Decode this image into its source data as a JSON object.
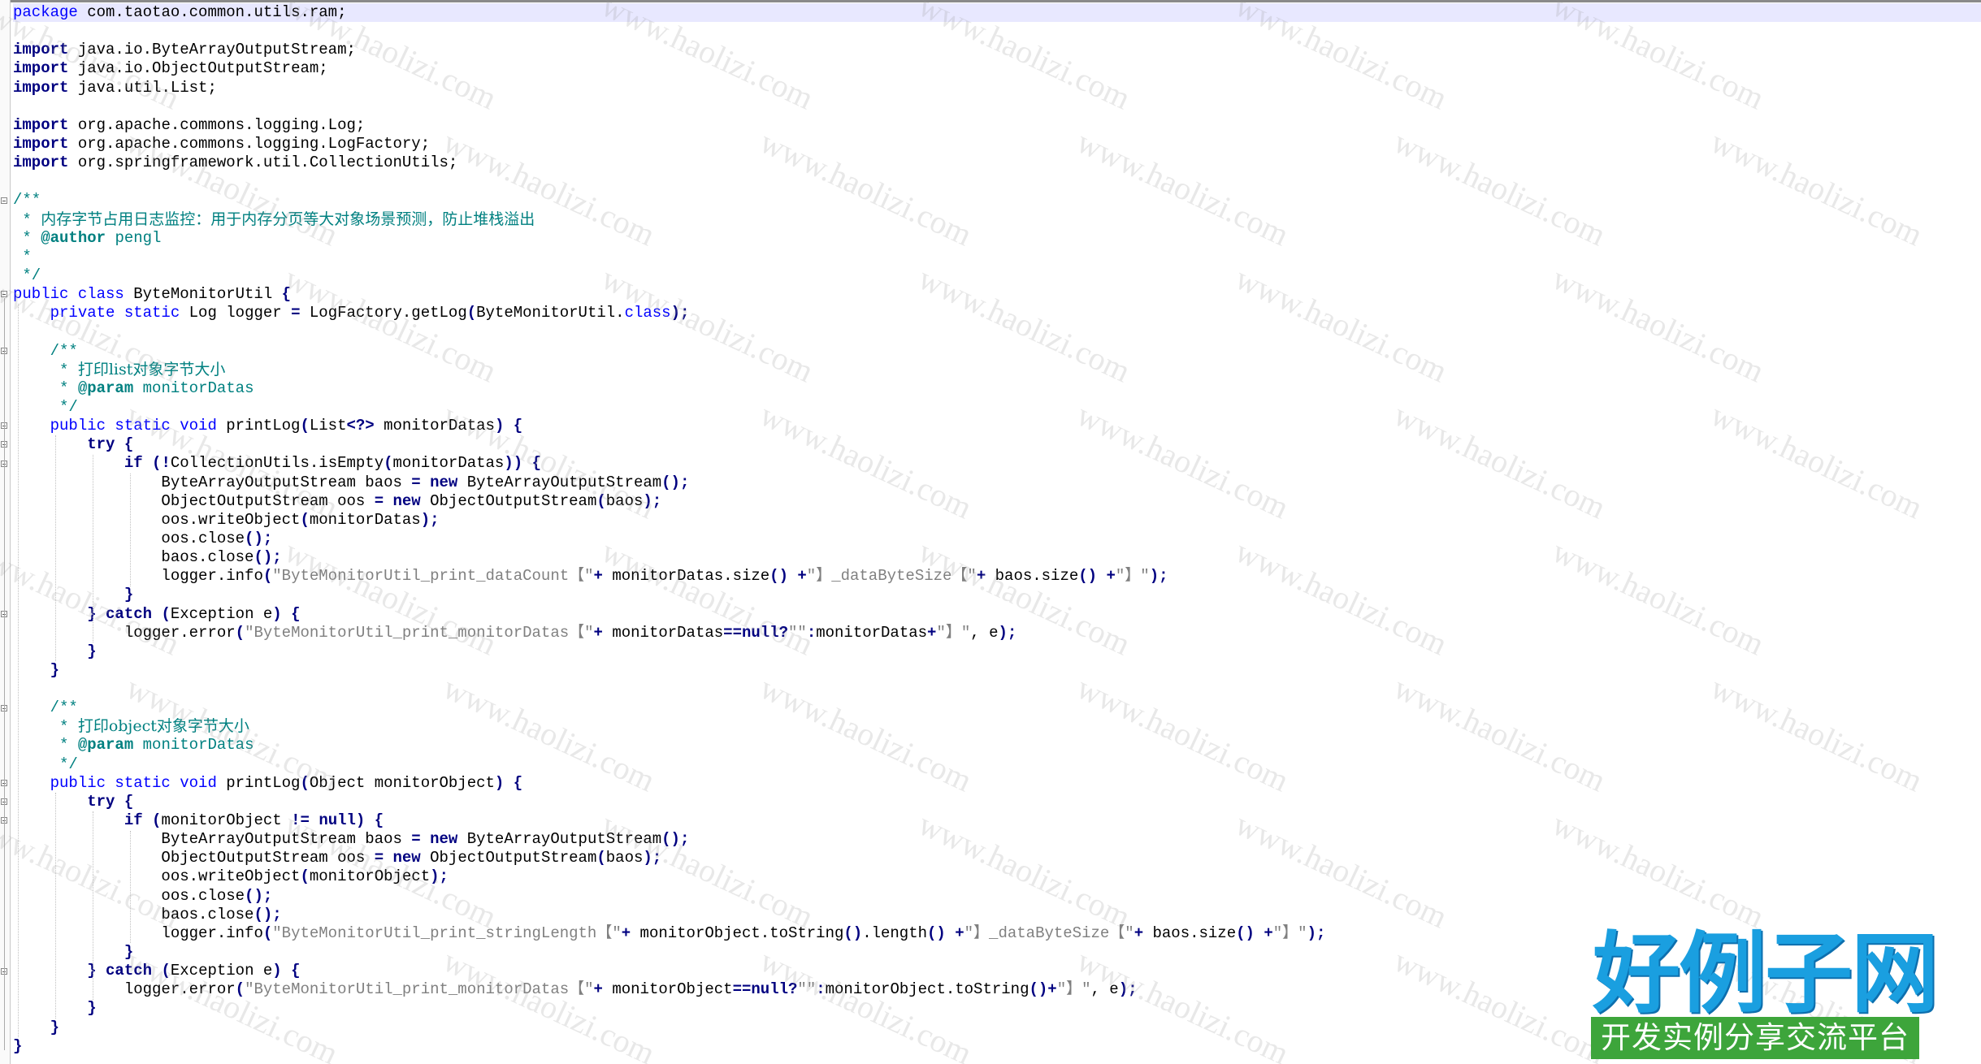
{
  "editor": {
    "lines": [
      [
        [
          "kw2",
          "package"
        ],
        [
          "t",
          " com.taotao.common.utils.ram;"
        ]
      ],
      [],
      [
        [
          "kw",
          "import"
        ],
        [
          "t",
          " java.io.ByteArrayOutputStream;"
        ]
      ],
      [
        [
          "kw",
          "import"
        ],
        [
          "t",
          " java.io.ObjectOutputStream;"
        ]
      ],
      [
        [
          "kw",
          "import"
        ],
        [
          "t",
          " java.util.List;"
        ]
      ],
      [],
      [
        [
          "kw",
          "import"
        ],
        [
          "t",
          " org.apache.commons.logging.Log;"
        ]
      ],
      [
        [
          "kw",
          "import"
        ],
        [
          "t",
          " org.apache.commons.logging.LogFactory;"
        ]
      ],
      [
        [
          "kw",
          "import"
        ],
        [
          "t",
          " org.springframework.util.CollectionUtils;"
        ]
      ],
      [],
      [
        [
          "cmt",
          "/**"
        ]
      ],
      [
        [
          "cmt",
          " * "
        ],
        [
          "cn",
          "内存字节占用日志监控：用于内存分页等大对象场景预测，防止堆栈溢出"
        ]
      ],
      [
        [
          "cmt",
          " * "
        ],
        [
          "cmttag",
          "@author"
        ],
        [
          "cmt",
          " pengl"
        ]
      ],
      [
        [
          "cmt",
          " *"
        ]
      ],
      [
        [
          "cmt",
          " */"
        ]
      ],
      [
        [
          "kw2",
          "public class"
        ],
        [
          "t",
          " ByteMonitorUtil "
        ],
        [
          "op",
          "{"
        ]
      ],
      [
        [
          "t",
          "    "
        ],
        [
          "kw2",
          "private static"
        ],
        [
          "t",
          " Log logger "
        ],
        [
          "op",
          "="
        ],
        [
          "t",
          " LogFactory.getLog"
        ],
        [
          "op",
          "("
        ],
        [
          "t",
          "ByteMonitorUtil."
        ],
        [
          "kw2",
          "class"
        ],
        [
          "op",
          ");"
        ]
      ],
      [],
      [
        [
          "t",
          "    "
        ],
        [
          "cmt",
          "/**"
        ]
      ],
      [
        [
          "t",
          "    "
        ],
        [
          "cmt",
          " * "
        ],
        [
          "cn",
          "打印list对象字节大小"
        ]
      ],
      [
        [
          "t",
          "    "
        ],
        [
          "cmt",
          " * "
        ],
        [
          "cmttag",
          "@param"
        ],
        [
          "cmt",
          " monitorDatas"
        ]
      ],
      [
        [
          "t",
          "    "
        ],
        [
          "cmt",
          " */"
        ]
      ],
      [
        [
          "t",
          "    "
        ],
        [
          "kw2",
          "public static void"
        ],
        [
          "t",
          " printLog"
        ],
        [
          "op",
          "("
        ],
        [
          "t",
          "List"
        ],
        [
          "op",
          "<?>"
        ],
        [
          "t",
          " monitorDatas"
        ],
        [
          "op",
          ")"
        ],
        [
          "t",
          " "
        ],
        [
          "op",
          "{"
        ]
      ],
      [
        [
          "t",
          "        "
        ],
        [
          "kw",
          "try"
        ],
        [
          "t",
          " "
        ],
        [
          "op",
          "{"
        ]
      ],
      [
        [
          "t",
          "            "
        ],
        [
          "kw",
          "if"
        ],
        [
          "t",
          " "
        ],
        [
          "op",
          "(!"
        ],
        [
          "t",
          "CollectionUtils.isEmpty"
        ],
        [
          "op",
          "("
        ],
        [
          "t",
          "monitorDatas"
        ],
        [
          "op",
          "))"
        ],
        [
          "t",
          " "
        ],
        [
          "op",
          "{"
        ]
      ],
      [
        [
          "t",
          "                ByteArrayOutputStream baos "
        ],
        [
          "op",
          "="
        ],
        [
          "t",
          " "
        ],
        [
          "kw",
          "new"
        ],
        [
          "t",
          " ByteArrayOutputStream"
        ],
        [
          "op",
          "();"
        ]
      ],
      [
        [
          "t",
          "                ObjectOutputStream oos "
        ],
        [
          "op",
          "="
        ],
        [
          "t",
          " "
        ],
        [
          "kw",
          "new"
        ],
        [
          "t",
          " ObjectOutputStream"
        ],
        [
          "op",
          "("
        ],
        [
          "t",
          "baos"
        ],
        [
          "op",
          ");"
        ]
      ],
      [
        [
          "t",
          "                oos.writeObject"
        ],
        [
          "op",
          "("
        ],
        [
          "t",
          "monitorDatas"
        ],
        [
          "op",
          ");"
        ]
      ],
      [
        [
          "t",
          "                oos.close"
        ],
        [
          "op",
          "();"
        ]
      ],
      [
        [
          "t",
          "                baos.close"
        ],
        [
          "op",
          "();"
        ]
      ],
      [
        [
          "t",
          "                logger.info"
        ],
        [
          "op",
          "("
        ],
        [
          "str",
          "\"ByteMonitorUtil_print_dataCount【\""
        ],
        [
          "op",
          "+"
        ],
        [
          "t",
          " monitorDatas.size"
        ],
        [
          "op",
          "()"
        ],
        [
          "t",
          " "
        ],
        [
          "op",
          "+"
        ],
        [
          "str",
          "\"】_dataByteSize【\""
        ],
        [
          "op",
          "+"
        ],
        [
          "t",
          " baos.size"
        ],
        [
          "op",
          "()"
        ],
        [
          "t",
          " "
        ],
        [
          "op",
          "+"
        ],
        [
          "str",
          "\"】\""
        ],
        [
          "op",
          ");"
        ]
      ],
      [
        [
          "t",
          "            "
        ],
        [
          "op",
          "}"
        ]
      ],
      [
        [
          "t",
          "        "
        ],
        [
          "op",
          "}"
        ],
        [
          "t",
          " "
        ],
        [
          "kw",
          "catch"
        ],
        [
          "t",
          " "
        ],
        [
          "op",
          "("
        ],
        [
          "t",
          "Exception e"
        ],
        [
          "op",
          ")"
        ],
        [
          "t",
          " "
        ],
        [
          "op",
          "{"
        ]
      ],
      [
        [
          "t",
          "            logger.error"
        ],
        [
          "op",
          "("
        ],
        [
          "str",
          "\"ByteMonitorUtil_print_monitorDatas【\""
        ],
        [
          "op",
          "+"
        ],
        [
          "t",
          " monitorDatas"
        ],
        [
          "op",
          "=="
        ],
        [
          "kw",
          "null"
        ],
        [
          "op",
          "?"
        ],
        [
          "str",
          "\"\""
        ],
        [
          "op",
          ":"
        ],
        [
          "t",
          "monitorDatas"
        ],
        [
          "op",
          "+"
        ],
        [
          "str",
          "\"】\""
        ],
        [
          "t",
          ", e"
        ],
        [
          "op",
          ");"
        ]
      ],
      [
        [
          "t",
          "        "
        ],
        [
          "op",
          "}"
        ]
      ],
      [
        [
          "t",
          "    "
        ],
        [
          "op",
          "}"
        ]
      ],
      [],
      [
        [
          "t",
          "    "
        ],
        [
          "cmt",
          "/**"
        ]
      ],
      [
        [
          "t",
          "    "
        ],
        [
          "cmt",
          " * "
        ],
        [
          "cn",
          "打印object对象字节大小"
        ]
      ],
      [
        [
          "t",
          "    "
        ],
        [
          "cmt",
          " * "
        ],
        [
          "cmttag",
          "@param"
        ],
        [
          "cmt",
          " monitorDatas"
        ]
      ],
      [
        [
          "t",
          "    "
        ],
        [
          "cmt",
          " */"
        ]
      ],
      [
        [
          "t",
          "    "
        ],
        [
          "kw2",
          "public static void"
        ],
        [
          "t",
          " printLog"
        ],
        [
          "op",
          "("
        ],
        [
          "t",
          "Object monitorObject"
        ],
        [
          "op",
          ")"
        ],
        [
          "t",
          " "
        ],
        [
          "op",
          "{"
        ]
      ],
      [
        [
          "t",
          "        "
        ],
        [
          "kw",
          "try"
        ],
        [
          "t",
          " "
        ],
        [
          "op",
          "{"
        ]
      ],
      [
        [
          "t",
          "            "
        ],
        [
          "kw",
          "if"
        ],
        [
          "t",
          " "
        ],
        [
          "op",
          "("
        ],
        [
          "t",
          "monitorObject "
        ],
        [
          "op",
          "!="
        ],
        [
          "t",
          " "
        ],
        [
          "kw",
          "null"
        ],
        [
          "op",
          ")"
        ],
        [
          "t",
          " "
        ],
        [
          "op",
          "{"
        ]
      ],
      [
        [
          "t",
          "                ByteArrayOutputStream baos "
        ],
        [
          "op",
          "="
        ],
        [
          "t",
          " "
        ],
        [
          "kw",
          "new"
        ],
        [
          "t",
          " ByteArrayOutputStream"
        ],
        [
          "op",
          "();"
        ]
      ],
      [
        [
          "t",
          "                ObjectOutputStream oos "
        ],
        [
          "op",
          "="
        ],
        [
          "t",
          " "
        ],
        [
          "kw",
          "new"
        ],
        [
          "t",
          " ObjectOutputStream"
        ],
        [
          "op",
          "("
        ],
        [
          "t",
          "baos"
        ],
        [
          "op",
          ");"
        ]
      ],
      [
        [
          "t",
          "                oos.writeObject"
        ],
        [
          "op",
          "("
        ],
        [
          "t",
          "monitorObject"
        ],
        [
          "op",
          ");"
        ]
      ],
      [
        [
          "t",
          "                oos.close"
        ],
        [
          "op",
          "();"
        ]
      ],
      [
        [
          "t",
          "                baos.close"
        ],
        [
          "op",
          "();"
        ]
      ],
      [
        [
          "t",
          "                logger.info"
        ],
        [
          "op",
          "("
        ],
        [
          "str",
          "\"ByteMonitorUtil_print_stringLength【\""
        ],
        [
          "op",
          "+"
        ],
        [
          "t",
          " monitorObject.toString"
        ],
        [
          "op",
          "()"
        ],
        [
          "t",
          ".length"
        ],
        [
          "op",
          "()"
        ],
        [
          "t",
          " "
        ],
        [
          "op",
          "+"
        ],
        [
          "str",
          "\"】_dataByteSize【\""
        ],
        [
          "op",
          "+"
        ],
        [
          "t",
          " baos.size"
        ],
        [
          "op",
          "()"
        ],
        [
          "t",
          " "
        ],
        [
          "op",
          "+"
        ],
        [
          "str",
          "\"】\""
        ],
        [
          "op",
          ");"
        ]
      ],
      [
        [
          "t",
          "            "
        ],
        [
          "op",
          "}"
        ]
      ],
      [
        [
          "t",
          "        "
        ],
        [
          "op",
          "}"
        ],
        [
          "t",
          " "
        ],
        [
          "kw",
          "catch"
        ],
        [
          "t",
          " "
        ],
        [
          "op",
          "("
        ],
        [
          "t",
          "Exception e"
        ],
        [
          "op",
          ")"
        ],
        [
          "t",
          " "
        ],
        [
          "op",
          "{"
        ]
      ],
      [
        [
          "t",
          "            logger.error"
        ],
        [
          "op",
          "("
        ],
        [
          "str",
          "\"ByteMonitorUtil_print_monitorDatas【\""
        ],
        [
          "op",
          "+"
        ],
        [
          "t",
          " monitorObject"
        ],
        [
          "op",
          "=="
        ],
        [
          "kw",
          "null"
        ],
        [
          "op",
          "?"
        ],
        [
          "str",
          "\"\""
        ],
        [
          "op",
          ":"
        ],
        [
          "t",
          "monitorObject.toString"
        ],
        [
          "op",
          "()+"
        ],
        [
          "str",
          "\"】\""
        ],
        [
          "t",
          ", e"
        ],
        [
          "op",
          ");"
        ]
      ],
      [
        [
          "t",
          "        "
        ],
        [
          "op",
          "}"
        ]
      ],
      [
        [
          "t",
          "    "
        ],
        [
          "op",
          "}"
        ]
      ],
      [
        [
          "op",
          "}"
        ]
      ]
    ]
  },
  "watermark": {
    "text": "www.haolizi.com"
  },
  "logo": {
    "title": "好例子网",
    "subtitle": "开发实例分享交流平台"
  },
  "colors": {
    "keyword": "#000080",
    "modifier": "#0000ff",
    "string": "#808080",
    "comment": "#008080",
    "logo_blue": "#1a9fe0",
    "logo_green": "#3da53b"
  }
}
